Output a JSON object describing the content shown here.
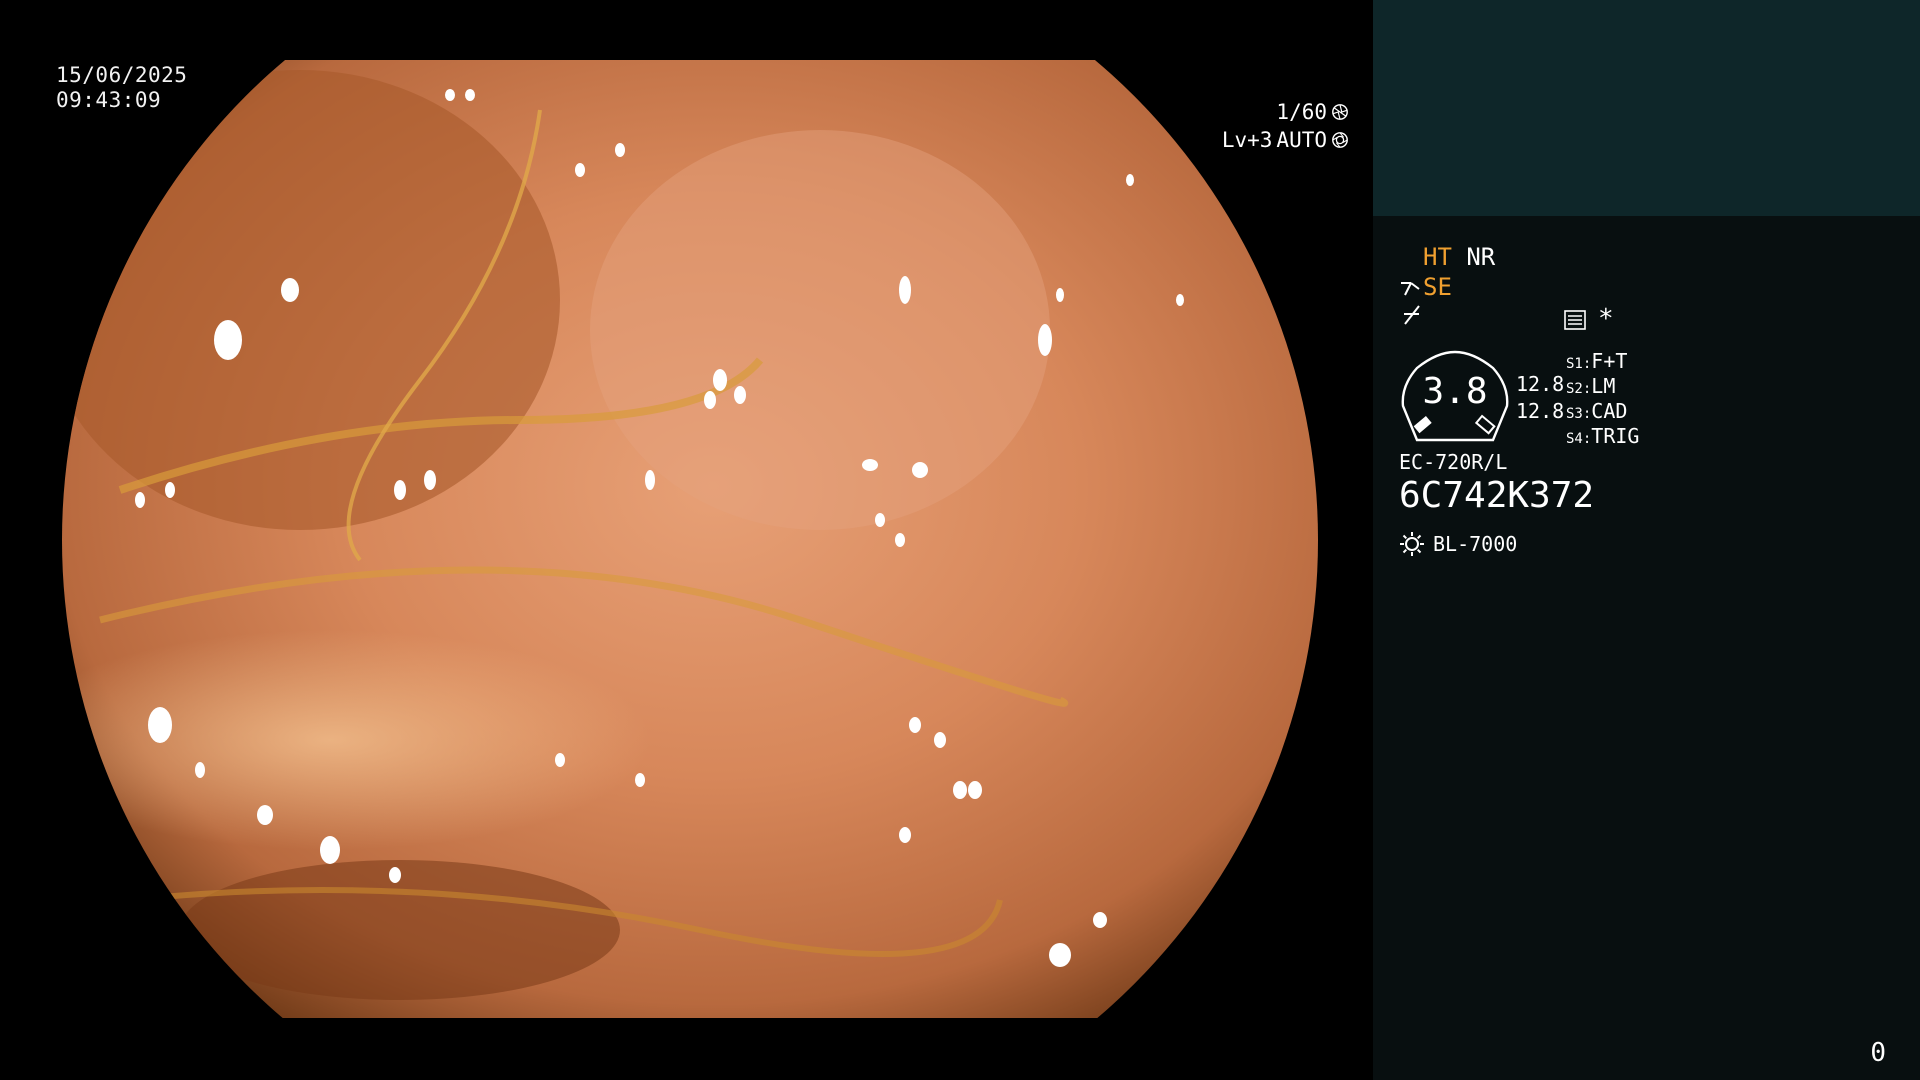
{
  "osd": {
    "date": "15/06/2025",
    "time": "09:43:09",
    "shutter": "1/60",
    "iris_level": "Lv+3",
    "iris_mode": "AUTO"
  },
  "side_panel": {
    "ht_label": "HT",
    "nr_label": "NR",
    "se_label": "SE",
    "gauge_value": "3.8",
    "gauge_side_values": [
      "12.8",
      "12.8"
    ],
    "scenes": [
      {
        "key": "S1",
        "value": "F+T"
      },
      {
        "key": "S2",
        "value": "LM"
      },
      {
        "key": "S3",
        "value": "CAD"
      },
      {
        "key": "S4",
        "value": "TRIG"
      }
    ],
    "scope_model": "EC-720R/L",
    "scope_serial": "6C742K372",
    "light_source": "BL-7000",
    "counter": "0"
  },
  "icons": [
    "shutter-icon",
    "iris-icon",
    "structure-enhance-icon",
    "edge-enhance-icon",
    "menu-icon",
    "star-icon",
    "gauge-icon",
    "light-source-icon"
  ],
  "colors": {
    "accent": "#f0a030",
    "panel_top": "#0e2629",
    "panel": "#080f10"
  }
}
